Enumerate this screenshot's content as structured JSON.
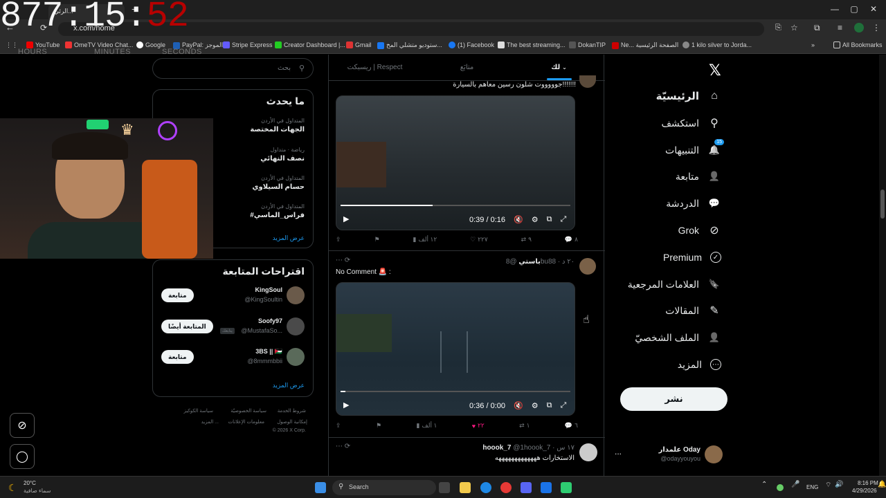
{
  "timer": {
    "hours": "877",
    "minutes": "15",
    "seconds": "52",
    "sep1": ":",
    "sep2": ":",
    "label_h": "HOURS",
    "label_m": "MINUTES",
    "label_s": "SECONDS"
  },
  "browser": {
    "tab_title": "الرئي...",
    "url": "x.com/home",
    "bookmarks": [
      "YouTube",
      "OmeTV Video Chat...",
      "Google",
      "PayPal: الموجز",
      "Stripe Express",
      "Creator Dashboard |...",
      "Gmail",
      "ستوديو متشلي المخ...",
      "(1) Facebook",
      "The best streaming...",
      "DokanTIP",
      "Ne... الصفحة الرئيسية",
      "1 kilo silver to Jorda..."
    ],
    "all_bookmarks": "All Bookmarks"
  },
  "nav": {
    "items": [
      {
        "label": "الرئيسيّة",
        "icon": "home-icon",
        "glyph": "⌂"
      },
      {
        "label": "استكشف",
        "icon": "search-icon",
        "glyph": "⚲"
      },
      {
        "label": "التنبيهات",
        "icon": "bell-icon",
        "glyph": "🔔"
      },
      {
        "label": "متابعة",
        "icon": "add-person-icon",
        "glyph": "👤"
      },
      {
        "label": "الدردشة",
        "icon": "chat-icon",
        "glyph": "💬"
      },
      {
        "label": "Grok",
        "icon": "grok-icon",
        "glyph": "⊘"
      },
      {
        "label": "Premium",
        "icon": "verified-icon",
        "glyph": "✓"
      },
      {
        "label": "العلامات المرجعية",
        "icon": "bookmark-icon",
        "glyph": "🔖"
      },
      {
        "label": "المقالات",
        "icon": "article-icon",
        "glyph": "✎"
      },
      {
        "label": "الملف الشخصيّ",
        "icon": "profile-icon",
        "glyph": "👤"
      },
      {
        "label": "المزيد",
        "icon": "more-icon",
        "glyph": "⋯"
      }
    ],
    "notif_count": "15",
    "post_button": "نشر",
    "account": {
      "name": "علمدار Oday",
      "handle": "@odayyouyou",
      "menu": "..."
    }
  },
  "tabs": [
    "لك",
    "متابَع",
    "ريسبكت | Respect"
  ],
  "posts": [
    {
      "text": "جوووووت شلون رسين معاهم بالسيارة!!!!!!!",
      "time": "0:39 / 0:16",
      "replies": "٨",
      "reposts": "٩",
      "likes": "٢٢٧",
      "views": "١٢ ألف"
    },
    {
      "name": "باستي",
      "handle": "@8bu88",
      "ago": "٢٠ د",
      "text": "No Comment 🚨 :",
      "time": "0:36 / 0:00",
      "replies": "٦",
      "reposts": "١",
      "likes": "٢٢",
      "views": "١ ألف"
    },
    {
      "name": "hoook_7",
      "handle": "@1hoook_7",
      "ago": "١٧ س",
      "text": "الاستخارات هههههههههههههه"
    }
  ],
  "right": {
    "search_placeholder": "بحث",
    "trends_title": "ما يحدث",
    "trends": [
      {
        "meta": "المتداول في الأردن",
        "name": "الجهات المختصة"
      },
      {
        "meta": "رياضة · متداول",
        "name": "نصف النهائي"
      },
      {
        "meta": "المتداول في الأردن",
        "name": "حسام السيلاوي"
      },
      {
        "meta": "المتداول في الأردن",
        "name": "#فراس_الماسي"
      }
    ],
    "show_more": "عرض المزيد",
    "follow_title": "اقتراحات المتابعة",
    "follows": [
      {
        "name": "KingSoul",
        "handle": "@KingSoultin",
        "btn": "متابعة"
      },
      {
        "name": "Soofy97",
        "handle": "@MustafaSo...",
        "btn": "المتابعة أيضًا",
        "tag": "يتابعك"
      },
      {
        "name": "3BS || 🇯🇴",
        "handle": "@8mmmbbii",
        "btn": "متابعة"
      }
    ],
    "footer": [
      "شروط الخدمة",
      "سياسة الخصوصيّة",
      "سياسة الكوكيز",
      "إمكانية الوصول",
      "معلومات الإعلانات",
      "المزيد ...",
      "© 2026 X Corp."
    ]
  },
  "taskbar": {
    "weather_temp": "20°C",
    "weather_desc": "سماء صافية",
    "search": "Search",
    "lang": "ENG",
    "time": "8:16 PM",
    "date": "4/29/2026"
  }
}
